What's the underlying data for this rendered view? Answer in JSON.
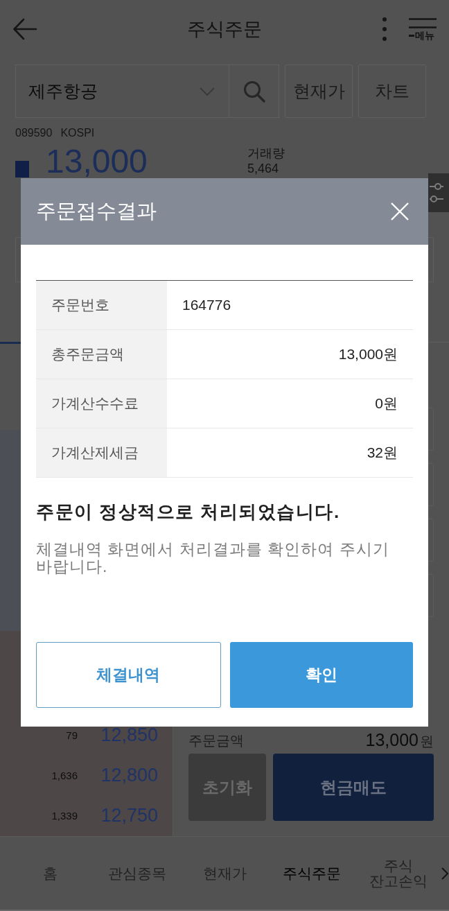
{
  "header": {
    "title": "주식주문",
    "menu_label": "메뉴"
  },
  "stock_search": {
    "value": "제주항공",
    "buttons": [
      "현재가",
      "차트"
    ]
  },
  "stock_info": {
    "code": "089590",
    "market": "KOSPI",
    "price": "13,000",
    "volume_label": "거래량",
    "volume": "5,464"
  },
  "order_book": {
    "bids": [
      {
        "quantity": "79",
        "price": "12,850"
      },
      {
        "quantity": "1,636",
        "price": "12,800"
      },
      {
        "quantity": "1,339",
        "price": "12,750"
      }
    ]
  },
  "order_summary": {
    "amount_label": "주문금액",
    "amount": "13,000",
    "unit": "원",
    "buttons": [
      {
        "label": "초기화",
        "kind": "reset"
      },
      {
        "label": "현금매도",
        "kind": "sell"
      }
    ]
  },
  "bottom_nav": {
    "items": [
      {
        "label": "홈",
        "selected": false
      },
      {
        "label": "관심종목",
        "selected": false
      },
      {
        "label": "현재가",
        "selected": false
      },
      {
        "label": "주식주문",
        "selected": true
      },
      {
        "label": "주식\n잔고손익",
        "selected": false
      }
    ]
  },
  "dialog": {
    "title": "주문접수결과",
    "rows": [
      {
        "label": "주문번호",
        "value": "164776",
        "kind": "id"
      },
      {
        "label": "총주문금액",
        "value": "13,000원",
        "kind": "amount"
      },
      {
        "label": "가계산수수료",
        "value": "0원",
        "kind": "amount"
      },
      {
        "label": "가계산제세금",
        "value": "32원",
        "kind": "amount"
      }
    ],
    "message": "주문이 정상적으로 처리되었습니다.",
    "note": "체결내역 화면에서 처리결과를 확인하여 주시기 바랍니다.",
    "buttons": [
      {
        "label": "체결내역",
        "kind": "secondary"
      },
      {
        "label": "확인",
        "kind": "primary"
      }
    ]
  }
}
